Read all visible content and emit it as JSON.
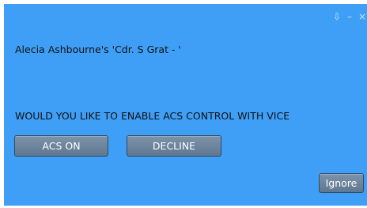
{
  "titlebar": {
    "icons": [
      "dock-icon",
      "minimize-icon",
      "close-icon"
    ],
    "dock_glyph": "⇩",
    "minimize_glyph": "–",
    "close_glyph": "×"
  },
  "notification": {
    "message": "Alecia Ashbourne's 'Cdr. S Grat - '",
    "question": "WOULD YOU LIKE TO ENABLE ACS CONTROL WITH VICE",
    "buttons": {
      "acs_on": "ACS ON",
      "decline": "DECLINE",
      "ignore": "Ignore"
    }
  },
  "colors": {
    "dialog_background": "#3f9ff6",
    "button_background": "#6c849c",
    "text": "#111111"
  }
}
